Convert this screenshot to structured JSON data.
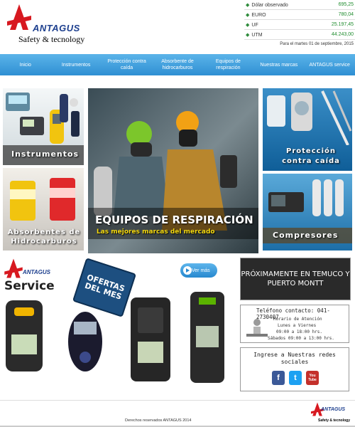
{
  "header": {
    "brand": "ANTAGUS",
    "tagline": "Safety & tecnology"
  },
  "rates": {
    "items": [
      {
        "label": "Dólar observado",
        "value": "695,25"
      },
      {
        "label": "EURO",
        "value": "780,04"
      },
      {
        "label": "UF",
        "value": "25.197,45"
      },
      {
        "label": "UTM",
        "value": "44.243,00"
      }
    ],
    "date": "Para el martes 01 de septiembre, 2015"
  },
  "nav": {
    "items": [
      {
        "label": "Inicio"
      },
      {
        "label": "Instrumentos"
      },
      {
        "label": "Protección contra caída"
      },
      {
        "label": "Absorbente de hidrocarburos"
      },
      {
        "label": "Equipos de respiración"
      },
      {
        "label": "Nuestras marcas"
      },
      {
        "label": "ANTAGUS service"
      }
    ]
  },
  "tiles": {
    "instrumentos": "Instrumentos",
    "absorbentes": "Absorbentes de Hidrocarburos",
    "main_title": "EQUIPOS DE RESPIRACIÓN",
    "main_sub": "Las mejores marcas del mercado",
    "proteccion": "Protección contra caída",
    "compresores": "Compresores"
  },
  "service": {
    "brand": "ANTAGUS",
    "label": "Service",
    "tag": "OFERTAS DEL MES",
    "ver_mas": "Ver más"
  },
  "side": {
    "proximamente": "PRÓXIMAMENTE EN TEMUCO Y PUERTO MONTT",
    "phone": "Teléfono contacto: 041-2730407",
    "hours_title": "Horario de Atención",
    "hours_days": "Lunes a Viernes",
    "hours_week": "09:00 a 18:00 hrs.",
    "hours_sat": "Sábados 09:00 a 13:00 hrs.",
    "social_title": "Ingrese a Nuestras redes sociales",
    "social_icons": [
      {
        "name": "facebook-icon",
        "glyph": "f",
        "color": "#3b5998"
      },
      {
        "name": "twitter-icon",
        "glyph": "t",
        "color": "#1da1f2"
      },
      {
        "name": "youtube-icon",
        "glyph": "You Tube",
        "color": "#c4302b"
      }
    ]
  },
  "footer": {
    "copyright": "Derechos reservados ANTAGUS 2014",
    "brand": "ANTAGUS",
    "tagline": "Safety & tecnology"
  }
}
